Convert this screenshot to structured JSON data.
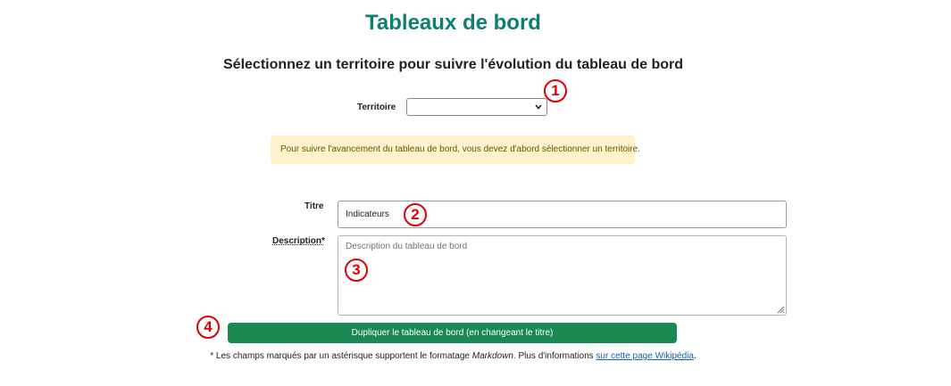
{
  "header": {
    "title": "Tableaux de bord",
    "subtitle": "Sélectionnez un territoire pour suivre l'évolution du tableau de bord"
  },
  "territory": {
    "label": "Territoire",
    "selected": ""
  },
  "alert": {
    "message": "Pour suivre l'avancement du tableau de bord, vous devez d'abord sélectionner un territoire."
  },
  "form": {
    "title_label": "Titre",
    "title_value": "Indicateurs",
    "description_label": "Description*",
    "description_placeholder": "Description du tableau de bord",
    "submit_label": "Dupliquer le tableau de bord (en changeant le titre)"
  },
  "footnote": {
    "prefix": "* Les champs marqués par un astérisque supportent le formatage ",
    "emphasis": "Markdown",
    "middle": ". Plus d'informations ",
    "link_text": "sur cette page Wikipédia",
    "suffix": "."
  },
  "annotations": [
    "1",
    "2",
    "3",
    "4"
  ],
  "colors": {
    "title": "#0f7f73",
    "button": "#1a8a52",
    "alert_bg": "#fff3cd",
    "annotation": "#e00000"
  }
}
